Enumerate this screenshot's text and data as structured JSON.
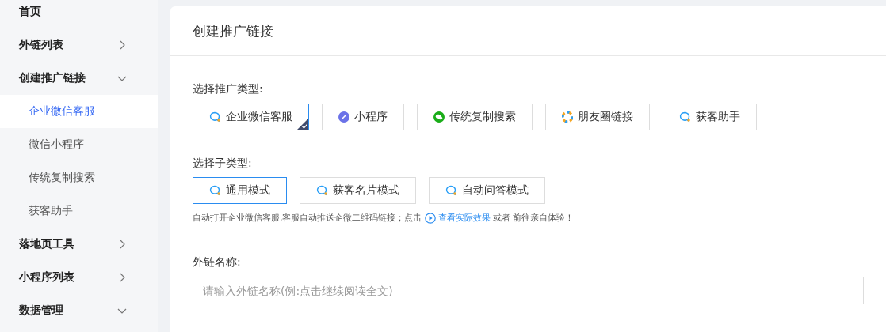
{
  "sidebar": {
    "items": [
      {
        "label": "首页"
      },
      {
        "label": "外链列表",
        "expanded": false
      },
      {
        "label": "创建推广链接",
        "expanded": true,
        "children": [
          {
            "label": "企业微信客服",
            "selected": true
          },
          {
            "label": "微信小程序",
            "selected": false
          },
          {
            "label": "传统复制搜索",
            "selected": false
          },
          {
            "label": "获客助手",
            "selected": false
          }
        ]
      },
      {
        "label": "落地页工具",
        "expanded": false
      },
      {
        "label": "小程序列表",
        "expanded": false
      },
      {
        "label": "数据管理",
        "expanded": true
      }
    ]
  },
  "card": {
    "title": "创建推广链接",
    "type_label": "选择推广类型:",
    "types": [
      {
        "label": "企业微信客服",
        "kind": "service",
        "selected": true
      },
      {
        "label": "小程序",
        "kind": "miniapp",
        "selected": false
      },
      {
        "label": "传统复制搜索",
        "kind": "wechat",
        "selected": false
      },
      {
        "label": "朋友圈链接",
        "kind": "moments",
        "selected": false
      },
      {
        "label": "获客助手",
        "kind": "service",
        "selected": false
      }
    ],
    "subtype_label": "选择子类型:",
    "subtypes": [
      {
        "label": "通用模式",
        "selected": true
      },
      {
        "label": "获客名片模式",
        "selected": false
      },
      {
        "label": "自动问答模式",
        "selected": false
      }
    ],
    "hint": {
      "text": "自动打开企业微信客服,客服自动推送企微二维码链接；点击",
      "link": "查看实际效果",
      "tail": "或者 前往亲自体验！"
    },
    "name_label": "外链名称:",
    "name_field": {
      "placeholder": "请输入外链名称(例:点击继续阅读全文)"
    }
  }
}
